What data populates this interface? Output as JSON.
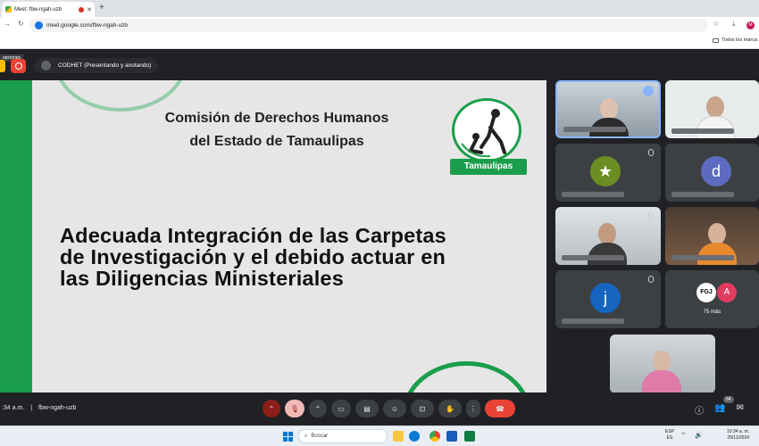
{
  "browser": {
    "tab_title": "Meet: fbw-ngah-uzb",
    "new_tab": "+",
    "url": "meet.google.com/fbw-ngah-uzb",
    "bookmarks_folder": "Todos los marca",
    "profile_initial": "M"
  },
  "meet": {
    "options_label": "opciones",
    "presenter_label": "CODHET (Presentando y anotando)",
    "slide": {
      "org_line1": "Comisión de Derechos Humanos",
      "org_line2": "del Estado de Tamaulipas",
      "logo_banner": "Tamaulipas",
      "headline_line1": "Adecuada Integración de las Carpetas",
      "headline_line2": "de Investigación y el debido actuar en",
      "headline_line3": "las Diligencias Ministeriales"
    },
    "tiles": {
      "avatar_d": "d",
      "avatar_j": "j",
      "fgj_label": "FGJ",
      "avatar_a": "A",
      "more_count": "75 más"
    },
    "bottom": {
      "time": ":34 a.m.",
      "separator": "|",
      "meeting_code": "fbw-ngah-uzb",
      "participants_badge": "84"
    }
  },
  "taskbar": {
    "search_placeholder": "Buscar",
    "lang_line1": "ESP",
    "lang_line2": "ES",
    "time": "10:34 a. m.",
    "date": "29/11/2024"
  },
  "colors": {
    "slide_green": "#1b9e4b",
    "end_call_red": "#ea4335",
    "meet_bg": "#202124"
  }
}
